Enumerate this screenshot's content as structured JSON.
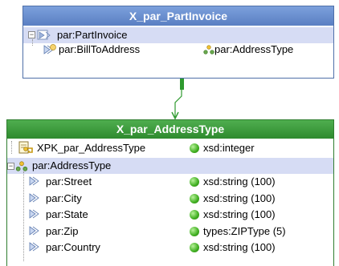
{
  "box1": {
    "title": "X_par_PartInvoice",
    "root_label": "par:PartInvoice",
    "child": {
      "name": "par:BillToAddress",
      "type": "par:AddressType"
    }
  },
  "box2": {
    "title": "X_par_AddressType",
    "key": {
      "name": "XPK_par_AddressType",
      "type": "xsd:integer"
    },
    "root_label": "par:AddressType",
    "fields": [
      {
        "name": "par:Street",
        "type": "xsd:string (100)"
      },
      {
        "name": "par:City",
        "type": "xsd:string (100)"
      },
      {
        "name": "par:State",
        "type": "xsd:string (100)"
      },
      {
        "name": "par:Zip",
        "type": "types:ZIPType (5)"
      },
      {
        "name": "par:Country",
        "type": "xsd:string (100)"
      }
    ]
  },
  "colors": {
    "box1_header": "#5a7fc2",
    "box2_header": "#2e8a2e",
    "row_highlight": "#d6dcf4",
    "type_dot": "#3fae20"
  },
  "icons": [
    "expander-icon",
    "element-icon",
    "complex-type-icon",
    "key-icon",
    "type-dot-icon",
    "arrow-icon"
  ]
}
